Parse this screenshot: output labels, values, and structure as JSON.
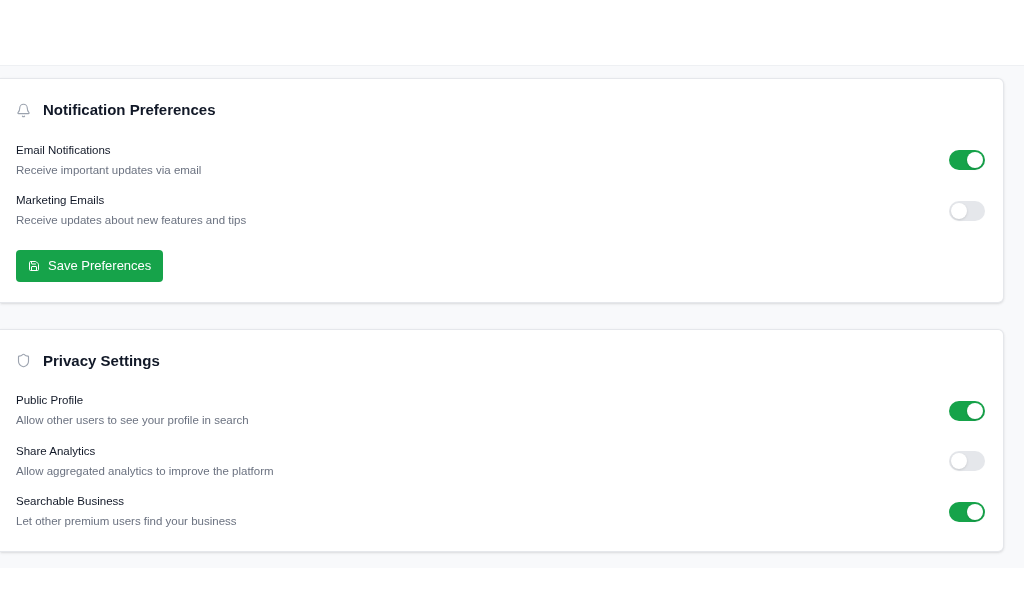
{
  "sections": [
    {
      "title": "Notification Preferences",
      "settings": [
        {
          "label": "Email Notifications",
          "description": "Receive important updates via email",
          "on": true
        },
        {
          "label": "Marketing Emails",
          "description": "Receive updates about new features and tips",
          "on": false
        }
      ],
      "button": {
        "label": "Save Preferences"
      }
    },
    {
      "title": "Privacy Settings",
      "settings": [
        {
          "label": "Public Profile",
          "description": "Allow other users to see your profile in search",
          "on": true
        },
        {
          "label": "Share Analytics",
          "description": "Allow aggregated analytics to improve the platform",
          "on": false
        },
        {
          "label": "Searchable Business",
          "description": "Let other premium users find your business",
          "on": true
        }
      ]
    }
  ]
}
